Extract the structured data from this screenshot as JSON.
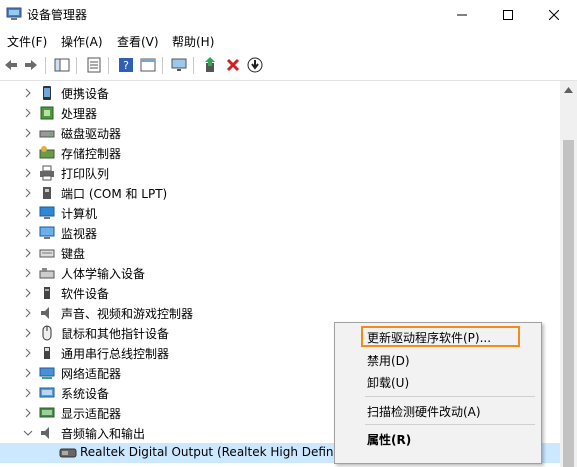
{
  "window": {
    "title": "设备管理器"
  },
  "menu": [
    "文件(F)",
    "操作(A)",
    "查看(V)",
    "帮助(H)"
  ],
  "toolbar": [
    "back-icon",
    "forward-icon",
    "show-hide-icon",
    "properties-icon",
    "help-icon",
    "view-icon",
    "monitor-icon",
    "update-driver-icon",
    "uninstall-icon",
    "download-icon"
  ],
  "tree": {
    "items": [
      {
        "label": "便携设备",
        "icon": "portable-device-icon"
      },
      {
        "label": "处理器",
        "icon": "processor-icon"
      },
      {
        "label": "磁盘驱动器",
        "icon": "disk-drive-icon"
      },
      {
        "label": "存储控制器",
        "icon": "storage-controller-icon"
      },
      {
        "label": "打印队列",
        "icon": "printer-icon"
      },
      {
        "label": "端口 (COM 和 LPT)",
        "icon": "port-icon"
      },
      {
        "label": "计算机",
        "icon": "computer-icon"
      },
      {
        "label": "监视器",
        "icon": "monitor-icon"
      },
      {
        "label": "键盘",
        "icon": "keyboard-icon"
      },
      {
        "label": "人体学输入设备",
        "icon": "hid-icon"
      },
      {
        "label": "软件设备",
        "icon": "software-device-icon"
      },
      {
        "label": "声音、视频和游戏控制器",
        "icon": "speaker-icon"
      },
      {
        "label": "鼠标和其他指针设备",
        "icon": "mouse-icon"
      },
      {
        "label": "通用串行总线控制器",
        "icon": "usb-icon"
      },
      {
        "label": "网络适配器",
        "icon": "network-adapter-icon"
      },
      {
        "label": "系统设备",
        "icon": "system-device-icon"
      },
      {
        "label": "显示适配器",
        "icon": "display-adapter-icon"
      },
      {
        "label": "音频输入和输出",
        "icon": "audio-icon"
      }
    ],
    "child": {
      "label": "Realtek Digital Output (Realtek High Definition Audio)",
      "icon": "audio-device-icon"
    }
  },
  "context_menu": {
    "items": [
      "更新驱动程序软件(P)...",
      "禁用(D)",
      "卸载(U)",
      "扫描检测硬件改动(A)",
      "属性(R)"
    ]
  },
  "colors": {
    "highlight": "#f28a1c",
    "selection": "#cce8ff"
  }
}
